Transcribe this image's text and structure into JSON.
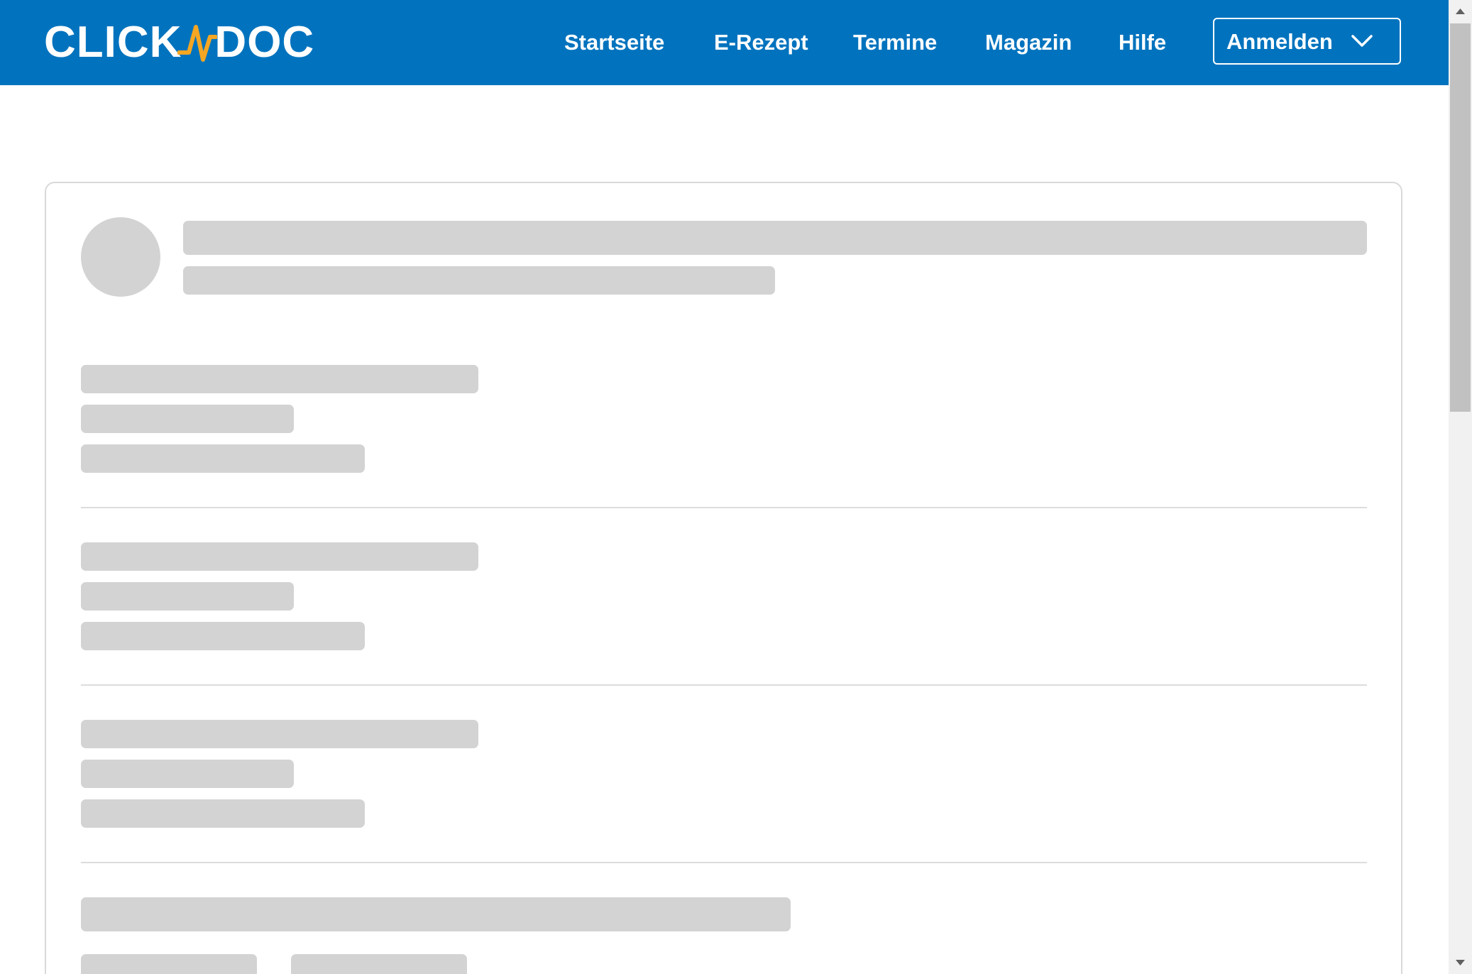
{
  "header": {
    "brand": {
      "left": "CLICK",
      "right": "DOC",
      "pulse_color": "#f5a623"
    },
    "nav": [
      {
        "label": "Startseite"
      },
      {
        "label": "E-Rezept"
      },
      {
        "label": "Termine"
      },
      {
        "label": "Magazin"
      },
      {
        "label": "Hilfe"
      }
    ],
    "login_label": "Anmelden",
    "login_icon": "chevron-down-icon"
  },
  "colors": {
    "header_bg": "#0173be",
    "skeleton": "#d3d3d3",
    "card_border": "#d9d9d9",
    "divider": "#dcdcdc",
    "scroll_track": "#f1f1f1",
    "scroll_thumb": "#c1c1c1"
  },
  "content": {
    "state": "loading-skeleton"
  }
}
